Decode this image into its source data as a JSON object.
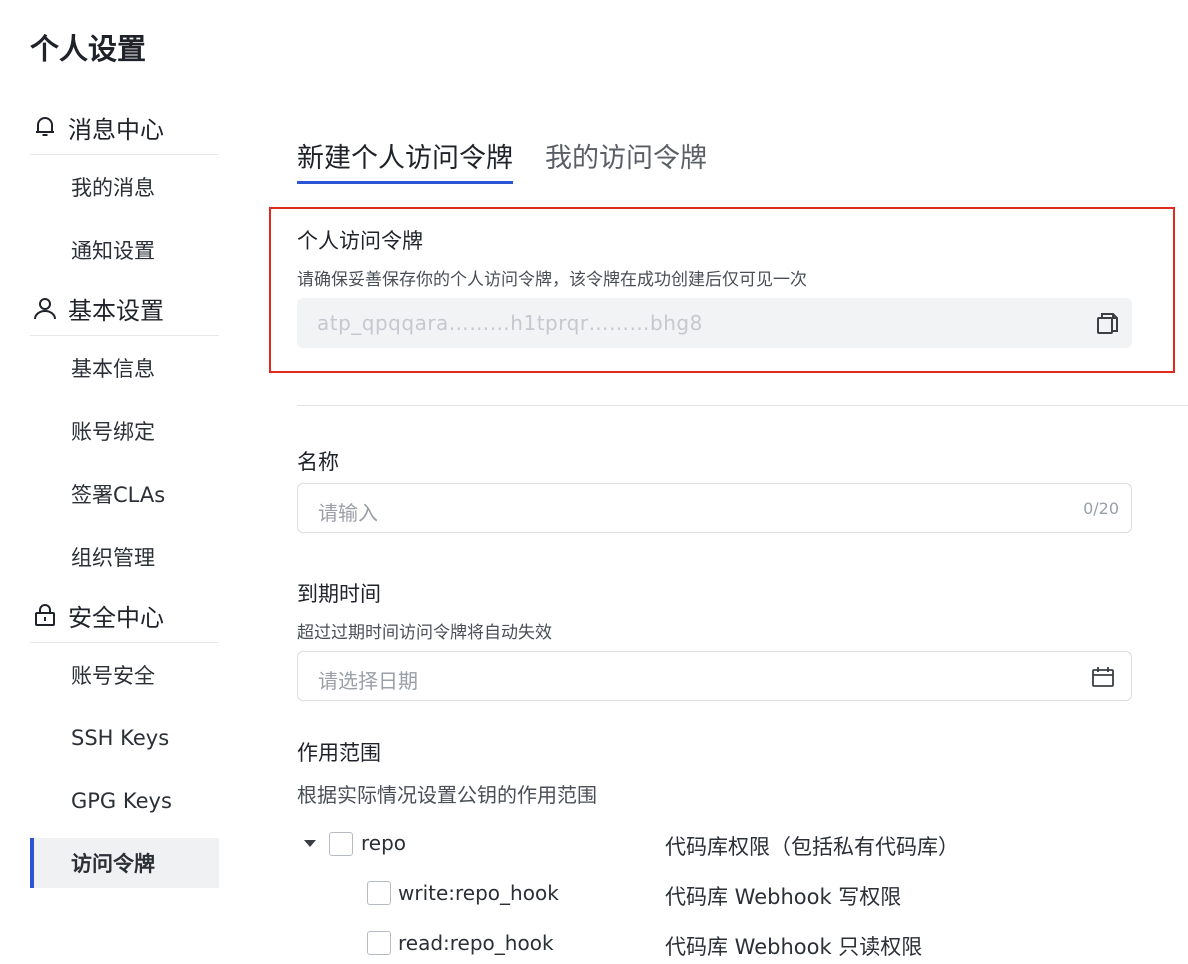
{
  "page_title": "个人设置",
  "sidebar": {
    "sections": [
      {
        "label": "消息中心",
        "icon": "bell-icon",
        "items": [
          "我的消息",
          "通知设置"
        ]
      },
      {
        "label": "基本设置",
        "icon": "user-icon",
        "items": [
          "基本信息",
          "账号绑定",
          "签署CLAs",
          "组织管理"
        ]
      },
      {
        "label": "安全中心",
        "icon": "lock-icon",
        "items": [
          "账号安全",
          "SSH Keys",
          "GPG Keys",
          "访问令牌"
        ]
      }
    ],
    "active_item": "访问令牌"
  },
  "tabs": [
    "新建个人访问令牌",
    "我的访问令牌"
  ],
  "active_tab": "新建个人访问令牌",
  "token": {
    "title": "个人访问令牌",
    "description": "请确保妥善保存你的个人访问令牌，该令牌在成功创建后仅可见一次",
    "value": "atp_qpqqara………h1tprqr………bhg8"
  },
  "form": {
    "name": {
      "label": "名称",
      "placeholder": "请输入",
      "counter": "0/20"
    },
    "expiry": {
      "label": "到期时间",
      "hint": "超过过期时间访问令牌将自动失效",
      "placeholder": "请选择日期"
    },
    "scope": {
      "label": "作用范围",
      "hint": "根据实际情况设置公钥的作用范围",
      "items": [
        {
          "name": "repo",
          "desc": "代码库权限（包括私有代码库）"
        },
        {
          "name": "write:repo_hook",
          "desc": "代码库 Webhook 写权限"
        },
        {
          "name": "read:repo_hook",
          "desc": "代码库 Webhook 只读权限"
        }
      ]
    }
  },
  "colors": {
    "accent": "#2b55d4",
    "highlight_border": "#e02b1d"
  }
}
